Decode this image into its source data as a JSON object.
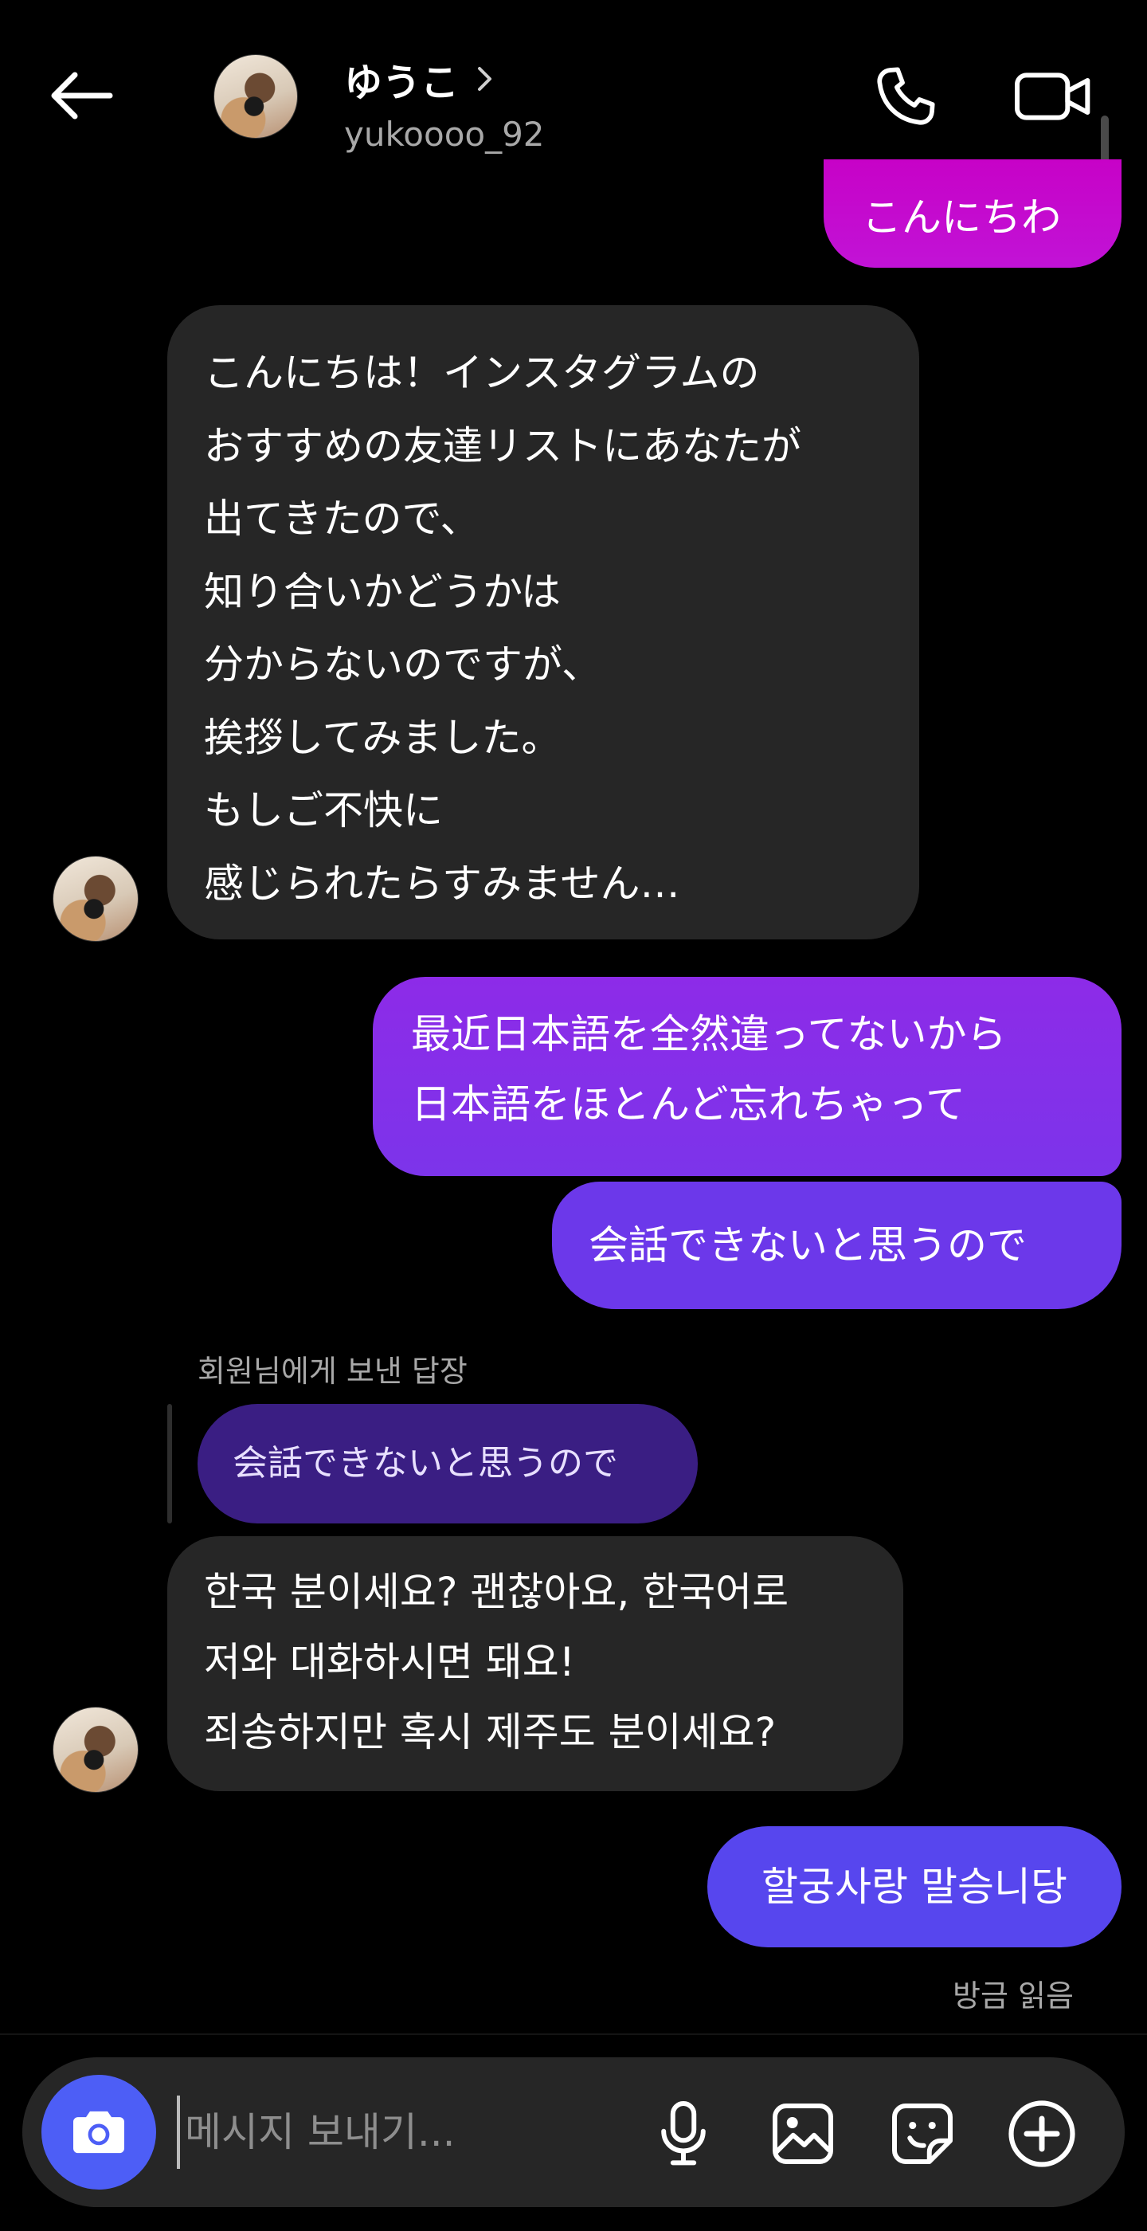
{
  "header": {
    "name": "ゆうこ",
    "username": "yukoooo_92"
  },
  "messages": {
    "hello": "こんにちわ",
    "intro_lines": [
      "こんにちは！インスタグラムの",
      "おすすめの友達リストにあなたが",
      "出てきたので、",
      "知り合いかどうかは",
      "分からないのですが、",
      "挨拶してみました。",
      "もしご不快に",
      "感じられたらすみません…"
    ],
    "sent1_lines": [
      "最近日本語を全然違ってないから",
      "日本語をほとんど忘れちゃって"
    ],
    "sent2": "会話できないと思うので",
    "reply_label": "회원님에게 보낸 답장",
    "reply_quote": "会話できないと思うので",
    "korean_lines": [
      "한국 분이세요? 괜찮아요, 한국어로",
      "저와 대화하시면 돼요!",
      "죄송하지만 혹시 제주도 분이세요?"
    ],
    "last": "할궁사랑 말승니당",
    "seen": "방금 읽음"
  },
  "composer": {
    "placeholder": "메시지 보내기..."
  },
  "icons": [
    "back-arrow-icon",
    "chevron-right-icon",
    "phone-icon",
    "video-camera-icon",
    "camera-icon",
    "microphone-icon",
    "image-icon",
    "sticker-icon",
    "plus-circle-icon"
  ],
  "colors": {
    "background": "#000000",
    "received_bubble": "#262626",
    "sent_top": "#c702c7",
    "sent_mid": "#8d2be8",
    "sent_bottom": "#5746ee",
    "reply_quote": "#3a1e83",
    "camera_button": "#4d5ef6"
  }
}
